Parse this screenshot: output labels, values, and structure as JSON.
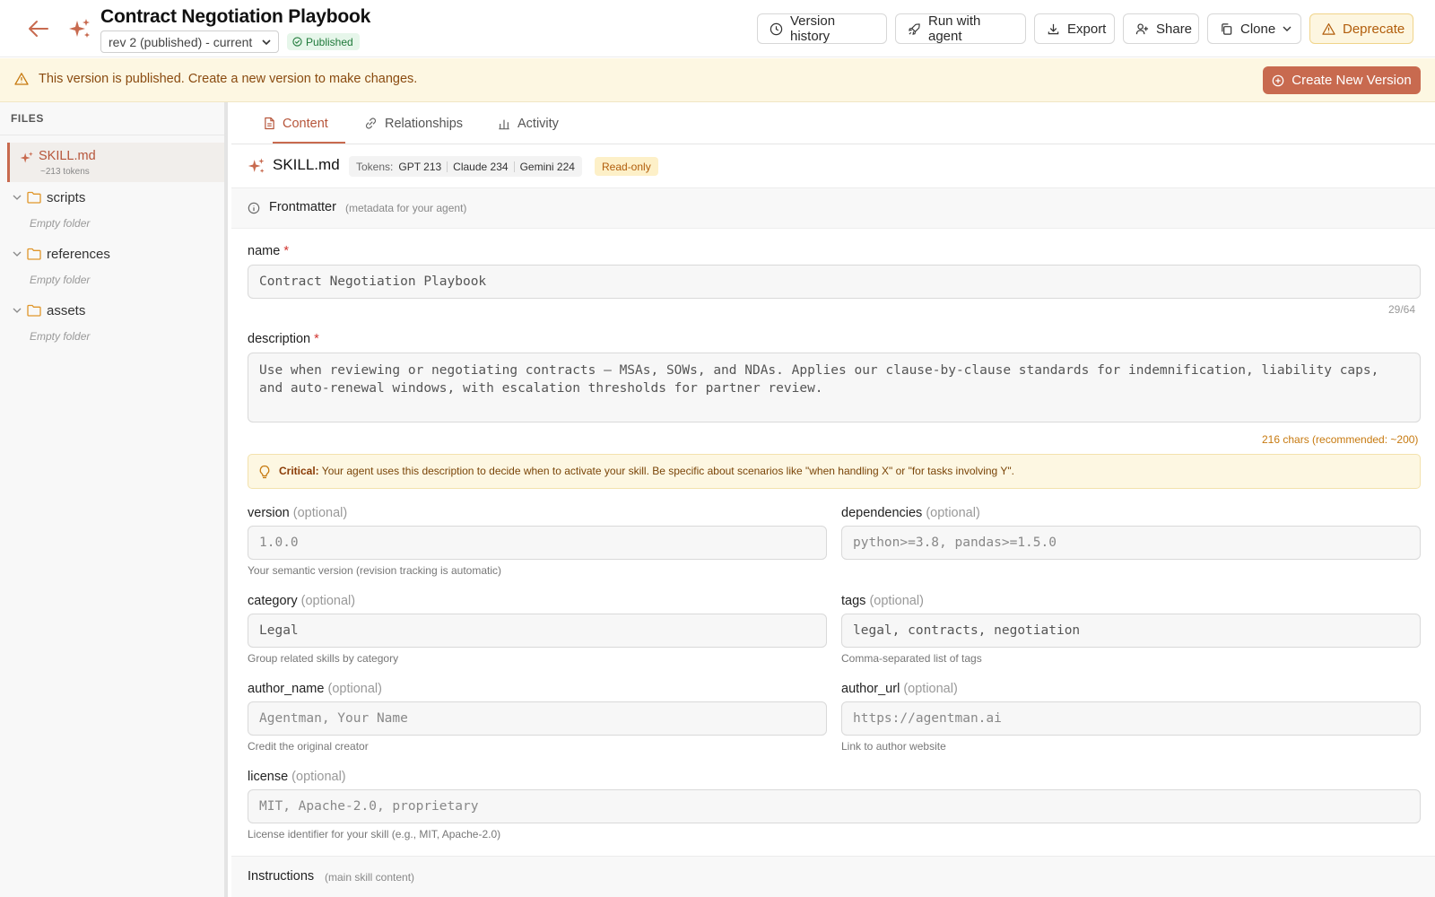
{
  "header": {
    "title": "Contract Negotiation Playbook",
    "revision_select": "rev 2 (published) - current",
    "status_badge": "Published",
    "buttons": {
      "version_history": "Version history",
      "run_with_agent": "Run with agent",
      "export": "Export",
      "share": "Share",
      "clone": "Clone",
      "deprecate": "Deprecate"
    }
  },
  "banner": {
    "message": "This version is published. Create a new version to make changes.",
    "create_button": "Create New Version"
  },
  "sidebar": {
    "heading": "FILES",
    "active_file": {
      "name": "SKILL.md",
      "tokens": "~213 tokens"
    },
    "folders": [
      {
        "name": "scripts",
        "empty_label": "Empty folder"
      },
      {
        "name": "references",
        "empty_label": "Empty folder"
      },
      {
        "name": "assets",
        "empty_label": "Empty folder"
      }
    ]
  },
  "tabs": [
    {
      "label": "Content",
      "active": true
    },
    {
      "label": "Relationships",
      "active": false
    },
    {
      "label": "Activity",
      "active": false
    }
  ],
  "filebar": {
    "filename": "SKILL.md",
    "tokens_label": "Tokens:",
    "tokens": [
      "GPT 213",
      "Claude 234",
      "Gemini 224"
    ],
    "readonly": "Read-only"
  },
  "frontmatter": {
    "title": "Frontmatter",
    "hint": "(metadata for your agent)"
  },
  "fields": {
    "name": {
      "label": "name",
      "required": "*",
      "value": "Contract Negotiation Playbook",
      "counter": "29/64"
    },
    "description": {
      "label": "description",
      "required": "*",
      "value": "Use when reviewing or negotiating contracts — MSAs, SOWs, and NDAs. Applies our clause-by-clause standards for indemnification, liability caps, and auto-renewal windows, with escalation thresholds for partner review.",
      "counter": "216 chars (recommended: ~200)"
    },
    "critical": {
      "strong": "Critical:",
      "text": " Your agent uses this description to decide when to activate your skill. Be specific about scenarios like \"when handling X\" or \"for tasks involving Y\"."
    },
    "version": {
      "label": "version",
      "optional": "(optional)",
      "placeholder": "1.0.0",
      "help": "Your semantic version (revision tracking is automatic)"
    },
    "dependencies": {
      "label": "dependencies",
      "optional": "(optional)",
      "placeholder": "python>=3.8, pandas>=1.5.0"
    },
    "category": {
      "label": "category",
      "optional": "(optional)",
      "value": "Legal",
      "help": "Group related skills by category"
    },
    "tags": {
      "label": "tags",
      "optional": "(optional)",
      "value": "legal, contracts, negotiation",
      "help": "Comma-separated list of tags"
    },
    "author_name": {
      "label": "author_name",
      "optional": "(optional)",
      "placeholder": "Agentman, Your Name",
      "help": "Credit the original creator"
    },
    "author_url": {
      "label": "author_url",
      "optional": "(optional)",
      "placeholder": "https://agentman.ai",
      "help": "Link to author website"
    },
    "license": {
      "label": "license",
      "optional": "(optional)",
      "placeholder": "MIT, Apache-2.0, proprietary",
      "help": "License identifier for your skill (e.g., MIT, Apache-2.0)"
    }
  },
  "instructions": {
    "title": "Instructions",
    "hint": "(main skill content)"
  },
  "colors": {
    "accent": "#c86a4f",
    "published": "#1f7a3a",
    "warning_bg": "#fdf7e2"
  }
}
